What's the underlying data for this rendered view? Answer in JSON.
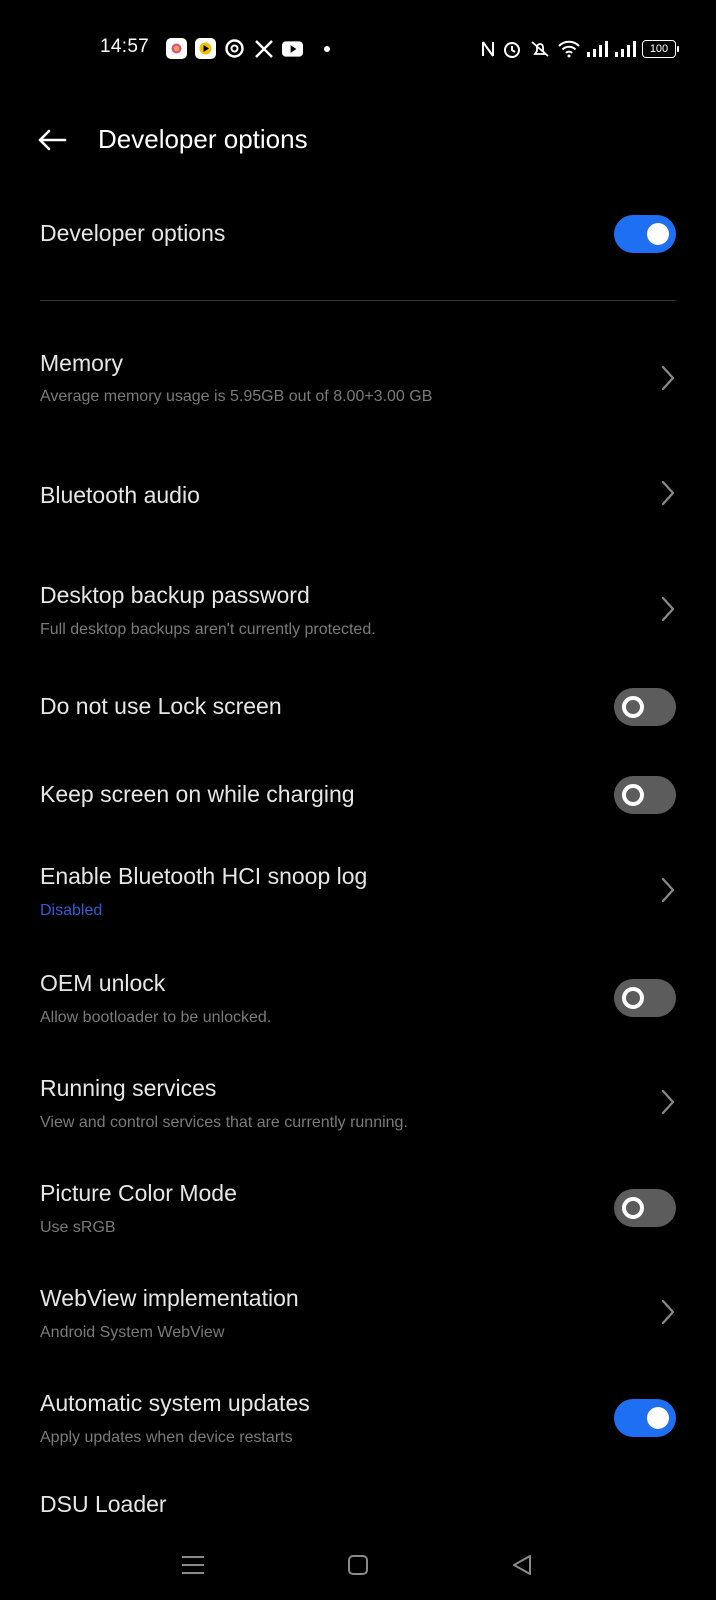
{
  "status_bar": {
    "time": "14:57",
    "battery": "100",
    "app_icons": [
      "photos-icon",
      "podcast-icon",
      "threads-icon",
      "x-icon",
      "youtube-icon"
    ],
    "system_icons": [
      "nfc-icon",
      "alarm-icon",
      "mute-icon",
      "wifi-icon",
      "signal-icon",
      "signal-icon"
    ]
  },
  "header": {
    "title": "Developer options"
  },
  "master_toggle": {
    "label": "Developer options",
    "state": "on"
  },
  "settings": [
    {
      "title": "Memory",
      "subtitle": "Average memory usage is 5.95GB out of 8.00+3.00 GB",
      "control": "chevron"
    },
    {
      "title": "Bluetooth audio",
      "subtitle": "",
      "control": "chevron"
    },
    {
      "title": "Desktop backup password",
      "subtitle": "Full desktop backups aren't currently protected.",
      "control": "chevron"
    },
    {
      "title": "Do not use Lock screen",
      "subtitle": "",
      "control": "toggle",
      "state": "off"
    },
    {
      "title": "Keep screen on while charging",
      "subtitle": "",
      "control": "toggle",
      "state": "off"
    },
    {
      "title": "Enable Bluetooth HCI snoop log",
      "subtitle": "Disabled",
      "control": "chevron"
    },
    {
      "title": "OEM unlock",
      "subtitle": "Allow bootloader to be unlocked.",
      "control": "toggle",
      "state": "off"
    },
    {
      "title": "Running services",
      "subtitle": "View and control services that are currently running.",
      "control": "chevron"
    },
    {
      "title": "Picture Color Mode",
      "subtitle": "Use sRGB",
      "control": "toggle",
      "state": "off"
    },
    {
      "title": "WebView implementation",
      "subtitle": "Android System WebView",
      "control": "chevron"
    },
    {
      "title": "Automatic system updates",
      "subtitle": "Apply updates when device restarts",
      "control": "toggle",
      "state": "on"
    },
    {
      "title": "DSU Loader",
      "subtitle": "",
      "control": "none"
    }
  ],
  "colors": {
    "background": "#000000",
    "toggle_on": "#1f6ff2",
    "toggle_off": "#5c5c5c",
    "link_blue": "#2a5fd9"
  }
}
